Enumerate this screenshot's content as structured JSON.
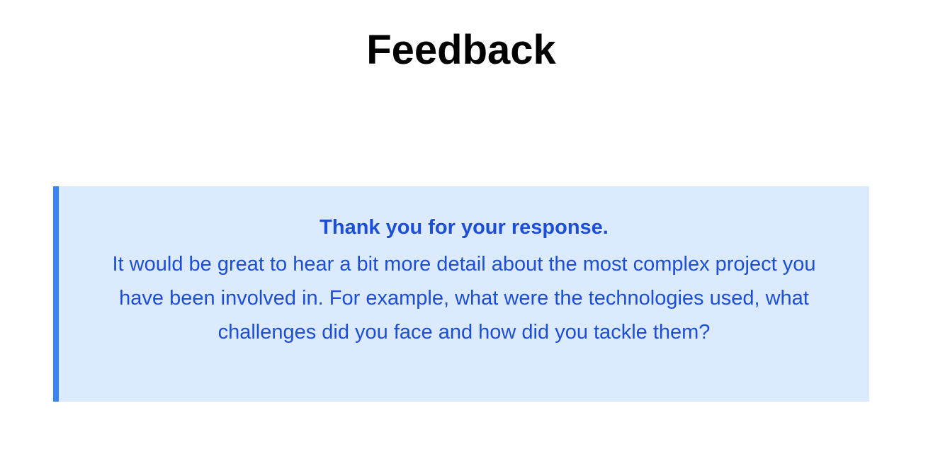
{
  "page": {
    "title": "Feedback"
  },
  "feedback": {
    "heading": "Thank you for your response.",
    "message": "It would be great to hear a bit more detail about the most complex project you have been involved in. For example, what were the technologies used, what challenges did you face and how did you tackle them?"
  },
  "colors": {
    "callout_background": "#dbeafe",
    "callout_border": "#3b82f6",
    "callout_text": "#1d4ed8",
    "title_text": "#000000"
  }
}
